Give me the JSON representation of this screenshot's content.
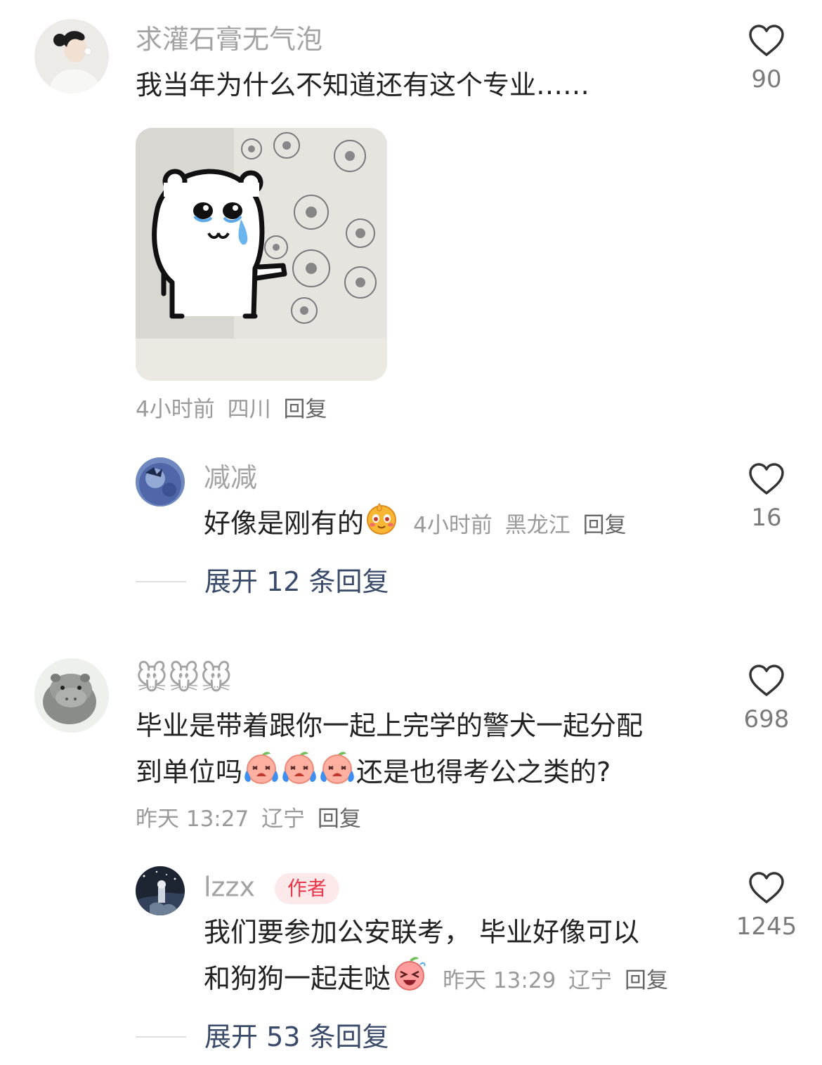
{
  "comments": [
    {
      "username": "求灌石膏无气泡",
      "text": "我当年为什么不知道还有这个专业……",
      "has_sticker": true,
      "time": "4小时前",
      "location": "四川",
      "reply_label": "回复",
      "likes": "90",
      "replies": [
        {
          "username": "减减",
          "text": "好像是刚有的",
          "time": "4小时前",
          "location": "黑龙江",
          "reply_label": "回复",
          "likes": "16"
        }
      ],
      "expand_label": "展开 12 条回复"
    },
    {
      "username": "🐭🐭🐭",
      "text_line1": "毕业是带着跟你一起上完学的警犬一起分配",
      "text_line2_a": "到单位吗",
      "text_line2_b": "还是也得考公之类的?",
      "time": "昨天 13:27",
      "location": "辽宁",
      "reply_label": "回复",
      "likes": "698",
      "replies": [
        {
          "username": "lzzx",
          "badge": "作者",
          "text_line1": "我们要参加公安联考， 毕业好像可以",
          "text_line2": "和狗狗一起走哒",
          "time": "昨天 13:29",
          "location": "辽宁",
          "reply_label": "回复",
          "likes": "1245"
        }
      ],
      "expand_label": "展开 53 条回复"
    }
  ],
  "icons": {
    "like": "heart-outline-icon",
    "sticker": "crying-bear-sticker",
    "emoji_1": "sweat-face-emoji",
    "emoji_2": "crying-peach-emoji",
    "emoji_3": "laughing-face-emoji"
  },
  "colors": {
    "username": "#a3a3a3",
    "text": "#222222",
    "meta": "#9a9a9a",
    "expand": "#3a4a6b",
    "author_badge_bg": "#fde8ea",
    "author_badge_text": "#e8374a"
  }
}
